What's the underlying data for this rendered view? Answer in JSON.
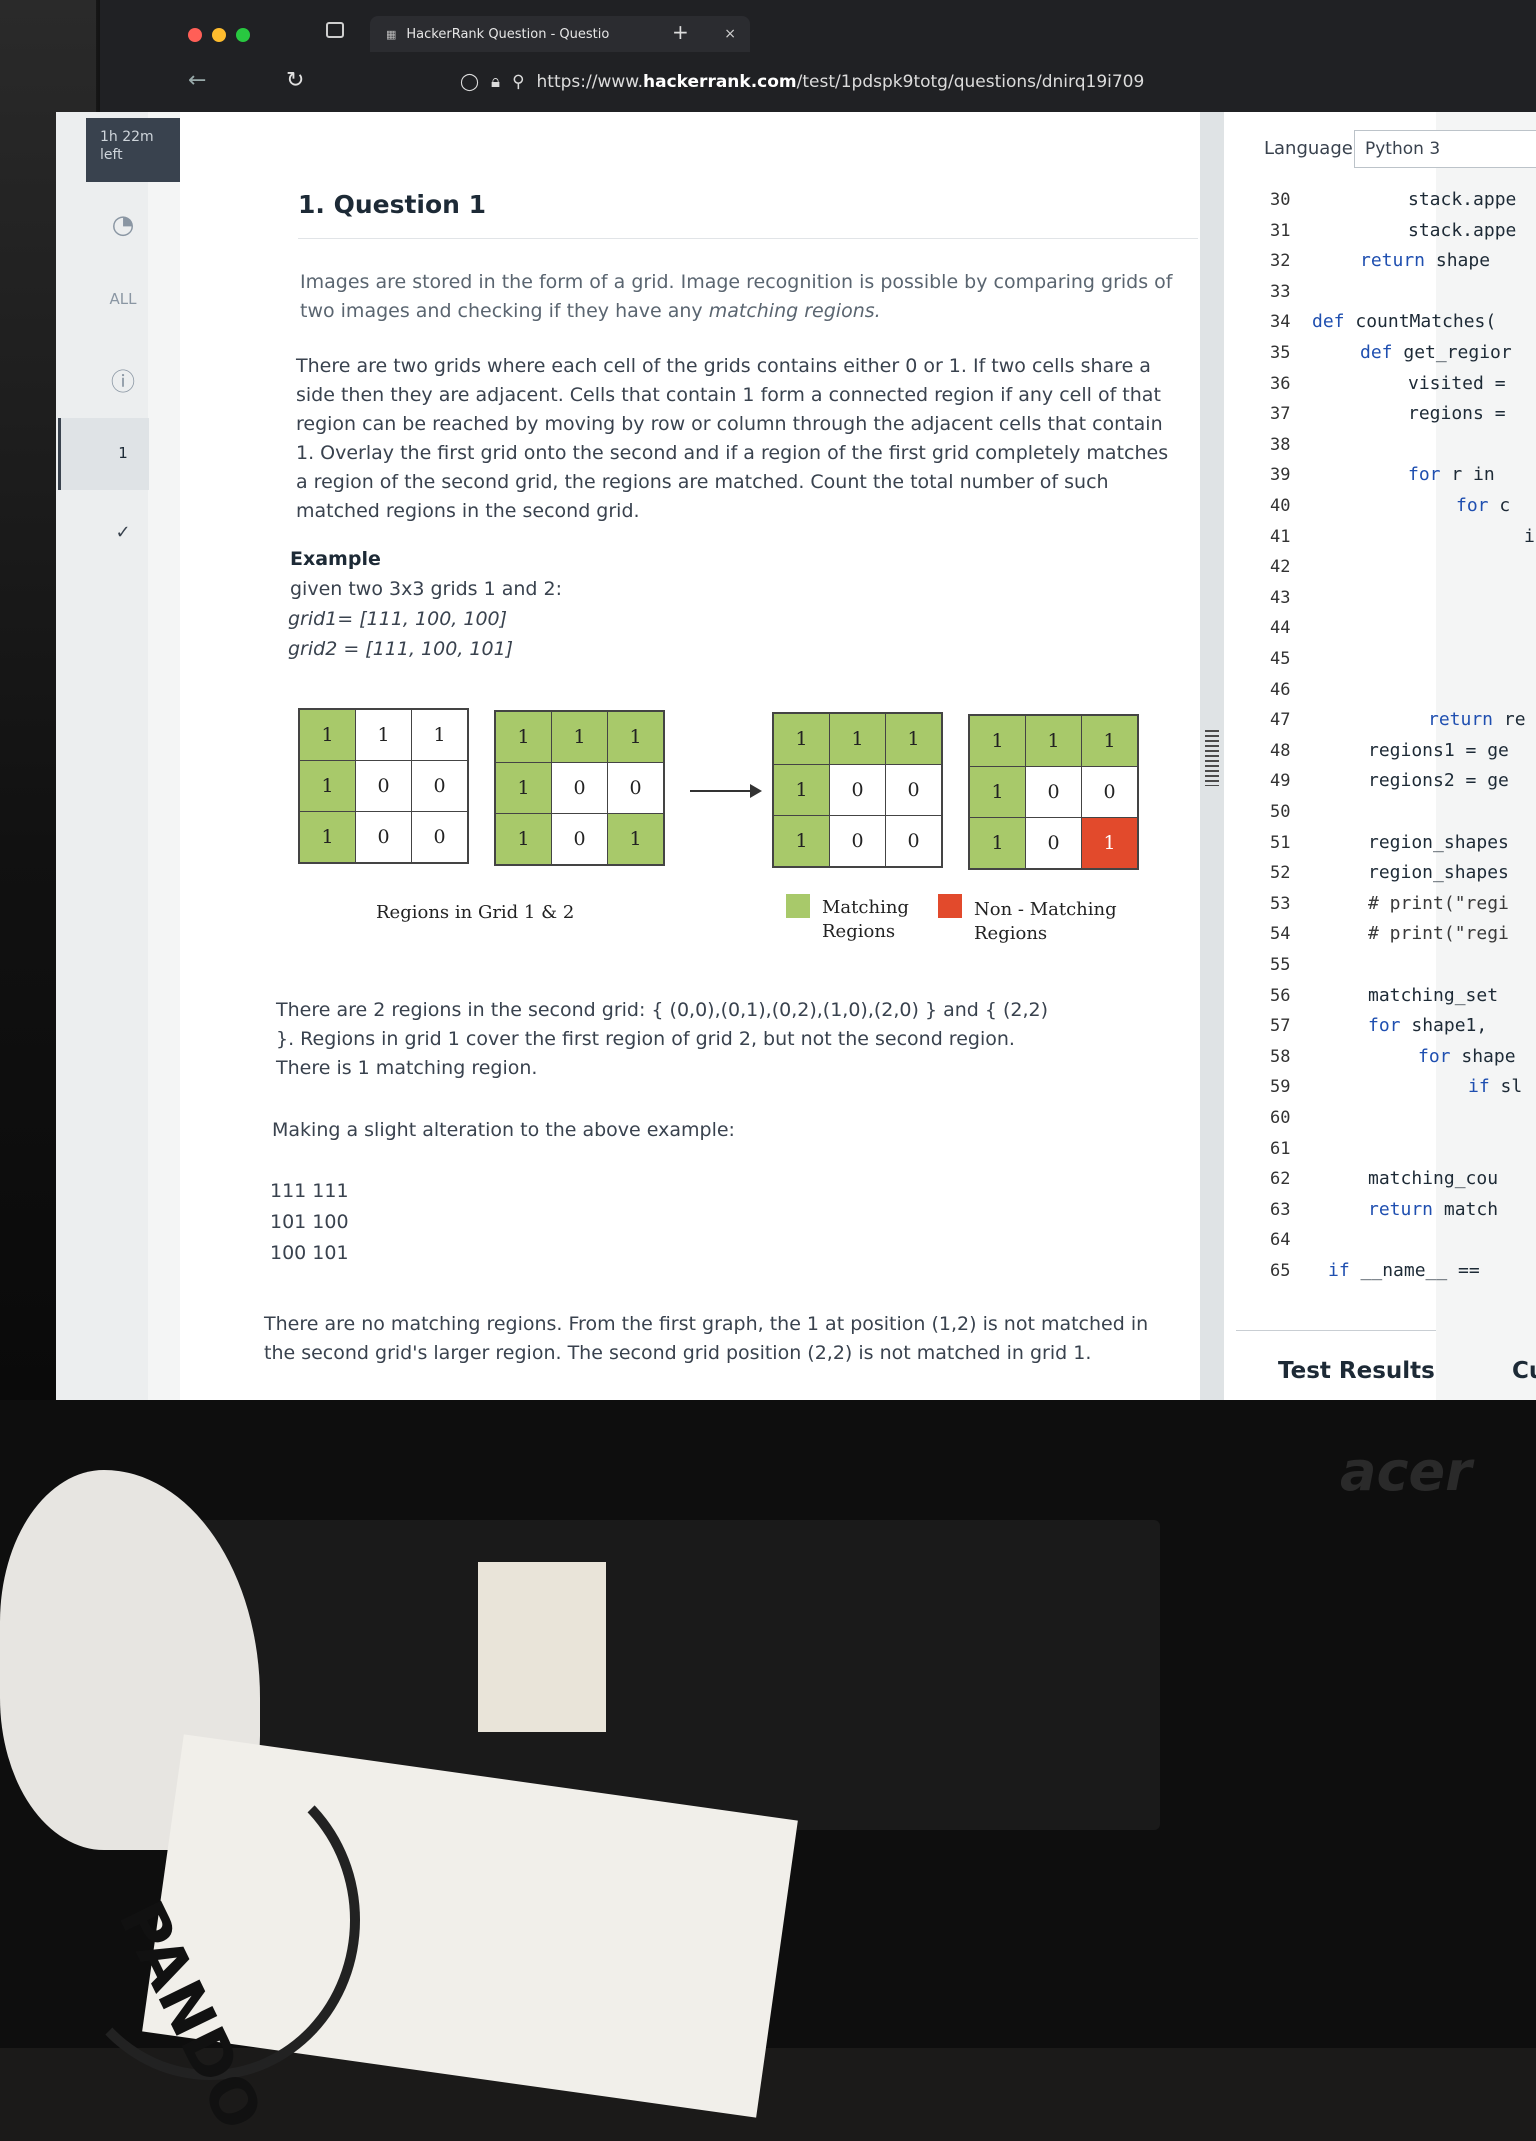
{
  "browser": {
    "tab_title": "HackerRank Question - Questio",
    "tab_close": "×",
    "new_tab": "+",
    "url_prefix": "https://www.",
    "url_domain": "hackerrank.com",
    "url_path": "/test/1pdspk9totg/questions/dnirq19i709"
  },
  "sidebar": {
    "timer_line1": "1h 22m",
    "timer_line2": "left",
    "all_label": "ALL",
    "info_icon": "info-icon",
    "question_number": "1",
    "check_icon": "check-icon"
  },
  "question": {
    "title": "1. Question 1",
    "p1_a": "Images are stored in the form of a grid. Image recognition is possible by comparing grids of two images and checking if they have any ",
    "p1_em": "matching regions.",
    "p2": "There are two grids where each cell of the grids contains either 0 or 1. If two cells share a side then they are adjacent. Cells that contain 1 form a connected region if any cell of that region can be reached by moving by row or column through the adjacent cells that contain 1. Overlay the first grid onto the second and if a region of the first grid completely matches a region of the second grid, the regions are matched. Count the total number of such matched regions in the second grid.",
    "example_heading": "Example",
    "example_lines": [
      "given two 3x3 grids 1 and 2:",
      "grid1= [111, 100, 100]",
      "grid2 = [111, 100, 101]"
    ],
    "grids": [
      {
        "cells": [
          "1",
          "1",
          "1",
          "1",
          "0",
          "0",
          "1",
          "0",
          "0"
        ],
        "colors": [
          "g",
          "",
          "",
          "g",
          "",
          "",
          "g",
          "",
          ""
        ]
      },
      {
        "cells": [
          "1",
          "1",
          "1",
          "1",
          "0",
          "0",
          "1",
          "0",
          "1"
        ],
        "colors": [
          "g",
          "g",
          "g",
          "g",
          "",
          "",
          "g",
          "",
          "g"
        ]
      },
      {
        "cells": [
          "1",
          "1",
          "1",
          "1",
          "0",
          "0",
          "1",
          "0",
          "0"
        ],
        "colors": [
          "g",
          "g",
          "g",
          "g",
          "",
          "",
          "g",
          "",
          ""
        ]
      },
      {
        "cells": [
          "1",
          "1",
          "1",
          "1",
          "0",
          "0",
          "1",
          "0",
          "1"
        ],
        "colors": [
          "g",
          "g",
          "g",
          "g",
          "",
          "",
          "g",
          "",
          "r"
        ]
      }
    ],
    "caption_regions": "Regions in Grid 1 & 2",
    "legend_matching_1": "Matching",
    "legend_matching_2": "Regions",
    "legend_nonmatching_1": "Non - Matching",
    "legend_nonmatching_2": "Regions",
    "p3": "There are 2 regions in the second grid: { (0,0),(0,1),(0,2),(1,0),(2,0) } and { (2,2) }. Regions in grid 1 cover the first region of grid 2, but not the second region. There is 1 matching region.",
    "p4": "Making a slight alteration to the above example:",
    "alt_lines": [
      "111 111",
      "101 100",
      "100 101"
    ],
    "p5": "There are no matching regions. From the first graph, the 1 at position (1,2) is not matched in the second grid's larger region. The second grid position (2,2) is not matched in grid 1."
  },
  "editor": {
    "language_label": "Language",
    "language_value": "Python 3",
    "line_numbers": [
      "30",
      "31",
      "32",
      "33",
      "34",
      "35",
      "36",
      "37",
      "38",
      "39",
      "40",
      "41",
      "42",
      "43",
      "44",
      "45",
      "46",
      "47",
      "48",
      "49",
      "50",
      "51",
      "52",
      "53",
      "54",
      "55",
      "56",
      "57",
      "58",
      "59",
      "60",
      "61",
      "62",
      "63",
      "64",
      "65"
    ],
    "code_lines": {
      "30": "stack.appe",
      "31": "stack.appe",
      "32": "return shape",
      "34": "def countMatches(",
      "35": "def get_regior",
      "36": "visited =",
      "37": "regions =",
      "39": "for r in",
      "40": "for c",
      "41": "i",
      "47": "return re",
      "48": "regions1 = ge",
      "49": "regions2 = ge",
      "51": "region_shapes",
      "52": "region_shapes",
      "53": "# print(\"regi",
      "54": "# print(\"regi",
      "56": "matching_set",
      "57": "for shape1,",
      "58": "for shape",
      "59": "if sl",
      "62": "matching_cou",
      "63": "return match",
      "65": "if __name__ =="
    },
    "test_results": "Test Results",
    "test_results_tab2": "Cu"
  },
  "scene": {
    "monitor_brand": "acer",
    "box_text": "PANDO"
  },
  "colors": {
    "match_green": "#a8c96a",
    "nonmatch_red": "#e24a2c",
    "keyword_blue": "#1f4fb0",
    "sidebar_dark": "#39424e"
  }
}
